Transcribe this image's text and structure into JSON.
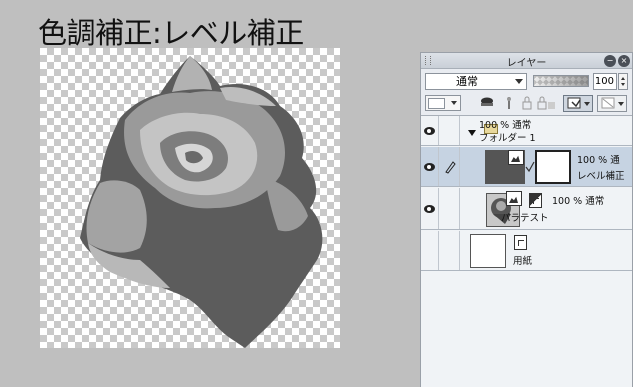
{
  "heading": "色調補正:レベル補正",
  "layer_panel": {
    "title": "レイヤー",
    "blend_mode": "通常",
    "opacity_value": "100",
    "opacity_fraction": 1.0,
    "layers": [
      {
        "name": "フォルダー 1",
        "info": "100 % 通常",
        "type": "folder"
      },
      {
        "name": "レベル補正",
        "info": "100 % 通",
        "type": "adjustment-levels",
        "selected": true
      },
      {
        "name": "パラテスト",
        "info": "100 % 通常",
        "type": "raster"
      },
      {
        "name": "用紙",
        "info": "",
        "type": "paper"
      }
    ]
  },
  "colors": {
    "rose_dark": "#585858",
    "rose_mid": "#8a8a8a",
    "rose_light": "#c8c8c8",
    "selected_row": "#c6d3e2"
  }
}
